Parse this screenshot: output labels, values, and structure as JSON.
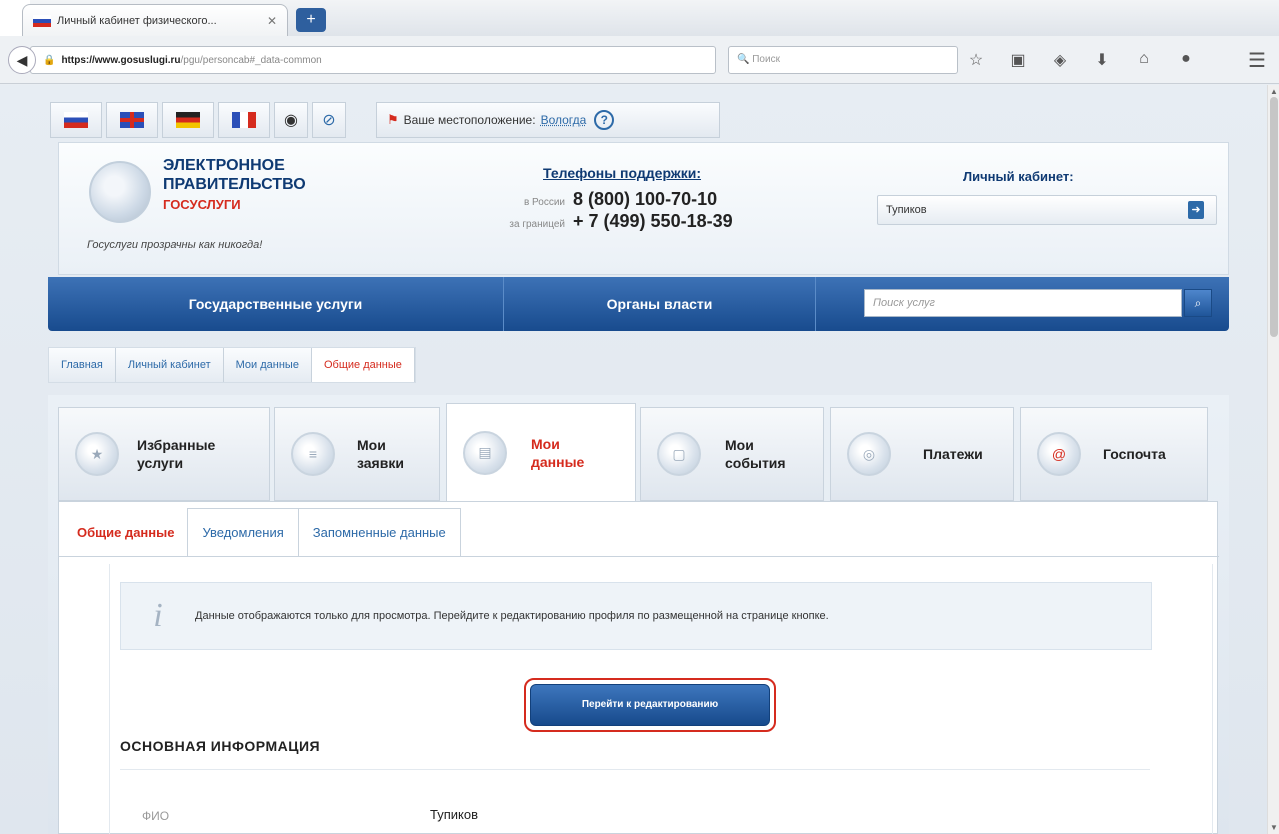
{
  "browser": {
    "tab_title": "Личный кабинет физического...",
    "tab_close": "✕",
    "new_tab": "+",
    "url_host": "https://www.gosuslugi.ru",
    "url_path": "/pgu/personcab#_data-common",
    "search_placeholder": "Поиск",
    "icons": [
      "star-icon",
      "clipboard-icon",
      "pocket-icon",
      "download-icon",
      "home-icon",
      "chat-icon",
      "menu-icon"
    ]
  },
  "site": {
    "location_label": "Ваше местоположение:",
    "location_city": "Вологда",
    "help": "?",
    "logo_line1": "ЭЛЕКТРОННОЕ",
    "logo_line2": "ПРАВИТЕЛЬСТВО",
    "logo_line3": "ГОСУСЛУГИ",
    "slogan": "Госуслуги прозрачны как никогда!",
    "phones_title": "Телефоны поддержки:",
    "phones": [
      {
        "label": "в России",
        "number": "8 (800) 100-70-10"
      },
      {
        "label": "за границей",
        "number": "+ 7 (499) 550-18-39"
      }
    ],
    "cabinet_title": "Личный кабинет:",
    "cabinet_user": "Тупиков"
  },
  "nav": {
    "services": "Государственные услуги",
    "authorities": "Органы власти",
    "search_placeholder": "Поиск услуг"
  },
  "breadcrumb": [
    "Главная",
    "Личный кабинет",
    "Мои данные",
    "Общие данные"
  ],
  "sections": [
    {
      "label": "Избранные\nуслуги",
      "icon": "star-icon"
    },
    {
      "label": "Мои\nзаявки",
      "icon": "list-icon"
    },
    {
      "label": "Мои\nданные",
      "icon": "id-card-icon",
      "active": true
    },
    {
      "label": "Мои\nсобытия",
      "icon": "calendar-icon"
    },
    {
      "label": "Платежи",
      "icon": "coin-icon"
    },
    {
      "label": "Госпочта",
      "icon": "at-icon"
    }
  ],
  "subtabs": [
    "Общие данные",
    "Уведомления",
    "Запомненные данные"
  ],
  "notice": "Данные отображаются только для просмотра. Перейдите к редактированию профиля по размещенной на странице кнопке.",
  "edit_button": "Перейти к редактированию",
  "section_title": "ОСНОВНАЯ ИНФОРМАЦИЯ",
  "fields": [
    {
      "label": "ФИО",
      "value": "Тупиков"
    }
  ],
  "colors": {
    "brand_blue": "#184b8e",
    "accent_red": "#d52b1e"
  }
}
